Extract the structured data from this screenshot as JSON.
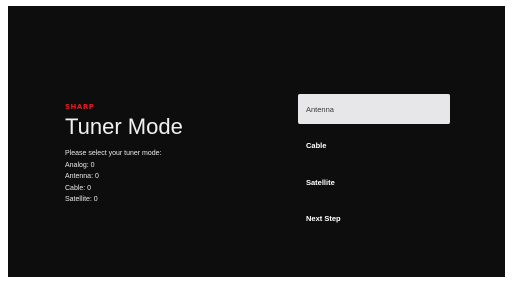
{
  "brand": "SHARP",
  "title": "Tuner Mode",
  "info": {
    "prompt": "Please select your tuner mode:",
    "counts": [
      "Analog: 0",
      "Antenna: 0",
      "Cable: 0",
      "Satellite: 0"
    ]
  },
  "options": [
    "Antenna",
    "Cable",
    "Satellite",
    "Next Step"
  ],
  "selected_option": "Antenna",
  "colors": {
    "brand": "#e01b22",
    "background": "#0d0d0d",
    "selected": "#e7e7e9"
  }
}
